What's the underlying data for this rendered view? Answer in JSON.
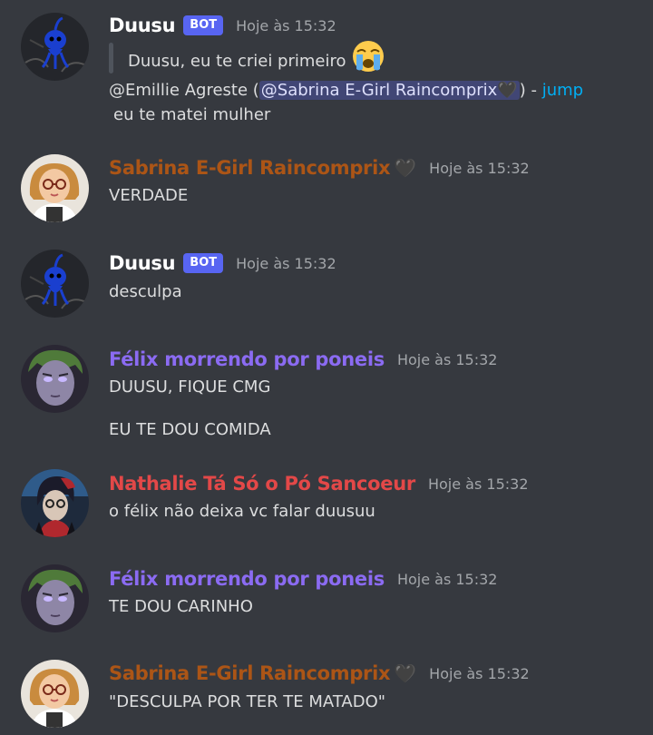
{
  "messages": [
    {
      "username": "Duusu",
      "badge": "BOT",
      "timestamp": "Hoje às 15:32",
      "quote": "Duusu, eu te criei primeiro",
      "reply_author": "@Emillie Agreste (",
      "mention": "@Sabrina E-Girl Raincomprix",
      "reply_close": ") - ",
      "jump": "jump",
      "text": "eu te matei mulher"
    },
    {
      "username": "Sabrina E-Girl Raincomprix",
      "timestamp": "Hoje às 15:32",
      "text": "VERDADE"
    },
    {
      "username": "Duusu",
      "badge": "BOT",
      "timestamp": "Hoje às 15:32",
      "text": "desculpa"
    },
    {
      "username": "Félix morrendo por poneis",
      "timestamp": "Hoje às 15:32",
      "text": "DUUSU, FIQUE CMG",
      "text2": "EU TE DOU COMIDA"
    },
    {
      "username": "Nathalie Tá Só o Pó Sancoeur",
      "timestamp": "Hoje às 15:32",
      "text": "o félix não deixa vc falar duusuu"
    },
    {
      "username": "Félix morrendo por poneis",
      "timestamp": "Hoje às 15:32",
      "text": "TE DOU CARINHO"
    },
    {
      "username": "Sabrina E-Girl Raincomprix",
      "timestamp": "Hoje às 15:32",
      "text": "\"DESCULPA POR TER TE MATADO\""
    }
  ],
  "colors": {
    "background": "#36393f",
    "duusu": "#ffffff",
    "sabrina": "#ac5516",
    "felix": "#8b6bf2",
    "nathalie": "#e34848",
    "bot_badge": "#5865f2",
    "link": "#00aff4"
  },
  "icons": [
    "duusu-avatar",
    "sabrina-avatar",
    "felix-avatar",
    "nathalie-avatar",
    "black-heart-icon",
    "crying-emoji-icon"
  ]
}
